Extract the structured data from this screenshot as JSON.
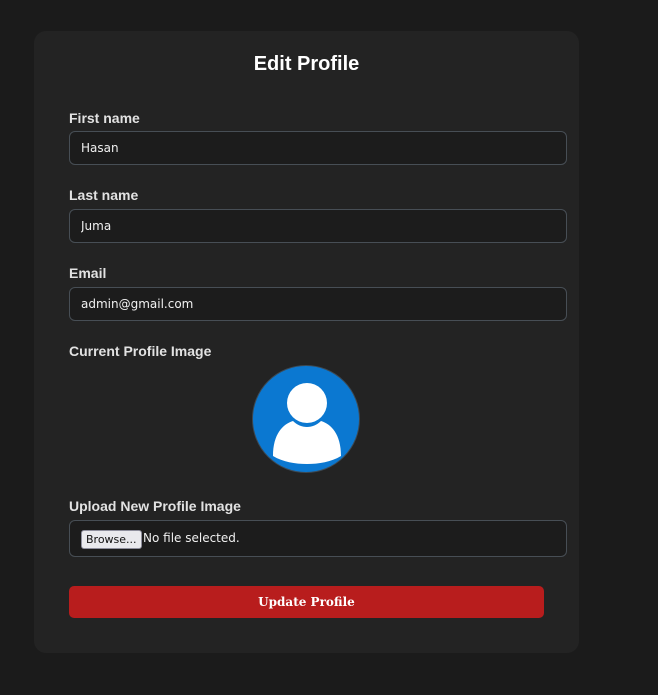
{
  "form": {
    "title": "Edit Profile",
    "first_name": {
      "label": "First name",
      "value": "Hasan"
    },
    "last_name": {
      "label": "Last name",
      "value": "Juma"
    },
    "email": {
      "label": "Email",
      "value": "admin@gmail.com"
    },
    "current_image": {
      "label": "Current Profile Image",
      "icon": "user-avatar-icon"
    },
    "upload": {
      "label": "Upload New Profile Image",
      "browse_label": "Browse...",
      "status": "No file selected."
    },
    "submit_label": "Update Profile"
  },
  "colors": {
    "page_background": "#1b1b1b",
    "card_background": "#232323",
    "avatar_blue": "#0b78d1",
    "button_red": "#b81d1d"
  }
}
